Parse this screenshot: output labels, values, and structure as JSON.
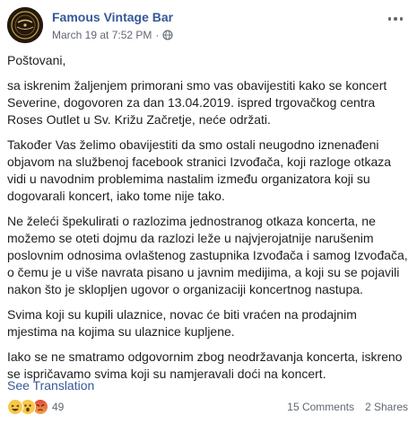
{
  "post": {
    "page_name": "Famous Vintage Bar",
    "timestamp": "March 19 at 7:52 PM",
    "separator": "·",
    "privacy_icon": "globe-icon",
    "more_icon": "more-dots-icon",
    "avatar_icon": "vintage-bar-logo-icon",
    "paragraphs": [
      "Poštovani,",
      "sa iskrenim žaljenjem primorani smo vas obavijestiti kako se koncert Severine, dogovoren za dan 13.04.2019. ispred trgovačkog centra Roses Outlet u Sv. Križu Začretje, neće održati.",
      "Također Vas želimo obavijestiti da smo ostali neugodno iznenađeni objavom na službenoj facebook stranici Izvođača, koji razloge otkaza vidi u navodnim problemima nastalim između organizatora koji su dogovarali koncert, iako tome nije tako.",
      "Ne želeći špekulirati o razlozima jednostranog otkaza koncerta, ne možemo se oteti dojmu da razlozi leže u najvjerojatnije narušenim poslovnim odnosima ovlaštenog zastupnika Izvođača i samog Izvođača, o čemu je u više navrata pisano u javnim medijima, a koji su se pojavili nakon što je sklopljen ugovor o organizaciji koncertnog nastupa.",
      "Svima koji su kupili ulaznice, novac će biti vraćen na prodajnim mjestima na kojima su ulaznice kupljene.",
      "Iako se ne smatramo odgovornim zbog neodržavanja koncerta, iskreno se ispričavamo svima koji su namjeravali doći na koncert."
    ],
    "see_translation": "See Translation",
    "reactions": {
      "icons": [
        "haha-reaction-icon",
        "wow-reaction-icon",
        "angry-reaction-icon"
      ],
      "count": "49"
    },
    "comments": "15 Comments",
    "shares": "2 Shares",
    "colors": {
      "link": "#365899",
      "meta": "#616770",
      "text": "#1c1e21"
    }
  }
}
